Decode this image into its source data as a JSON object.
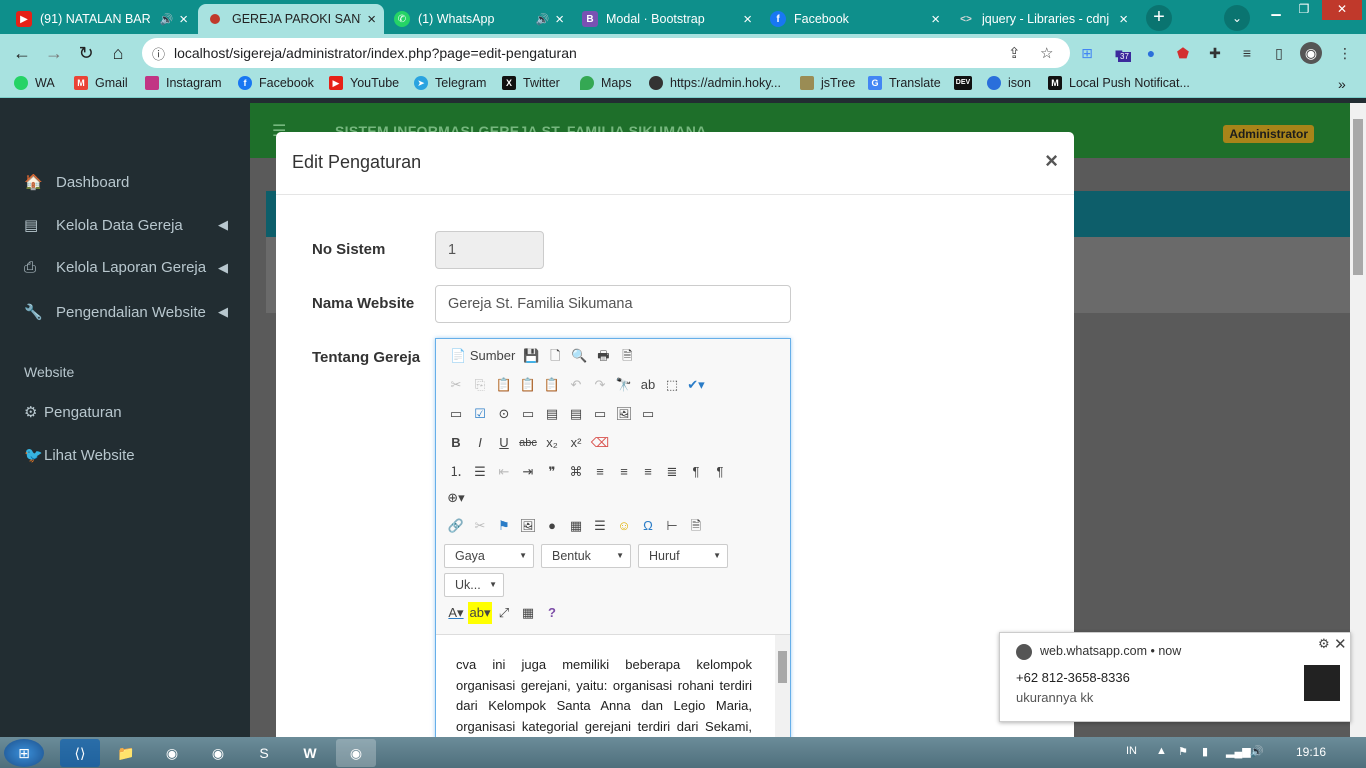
{
  "browser": {
    "tabs": [
      {
        "title": "(91) NATALAN BAR",
        "icon": "youtube-icon",
        "active": false
      },
      {
        "title": "GEREJA PAROKI SANTA",
        "icon": "site-icon",
        "active": true
      },
      {
        "title": "(1) WhatsApp",
        "icon": "whatsapp-icon",
        "active": false
      },
      {
        "title": "Modal · Bootstrap",
        "icon": "bootstrap-icon",
        "active": false
      },
      {
        "title": "Facebook",
        "icon": "facebook-icon",
        "active": false
      },
      {
        "title": "jquery - Libraries - cdnj",
        "icon": "cdnjs-icon",
        "active": false
      }
    ],
    "new_tab": "+",
    "url": "localhost/sigereja/administrator/index.php?page=edit-pengaturan",
    "extension_badge": "37",
    "bookmarks": [
      "WA",
      "Gmail",
      "Instagram",
      "Facebook",
      "YouTube",
      "Telegram",
      "Twitter",
      "Maps",
      "https://admin.hoky...",
      "jsTree",
      "Translate",
      "ison",
      "Local Push Notificat..."
    ]
  },
  "app": {
    "brand": "SISTEM INFORMASI GEREJA ST. FAMILIA SIKUMANA",
    "user_label": "Administrator",
    "sidebar": {
      "items": [
        {
          "label": "Dashboard",
          "icon": "dashboard-icon",
          "chevron": false
        },
        {
          "label": "Kelola Data Gereja",
          "icon": "book-icon",
          "chevron": true
        },
        {
          "label": "Kelola Laporan Gereja",
          "icon": "print-icon",
          "chevron": true
        },
        {
          "label": "Pengendalian Website",
          "icon": "wrench-icon",
          "chevron": true
        }
      ],
      "section_header": "Website",
      "section_items": [
        {
          "label": "Pengaturan",
          "icon": "gear-icon"
        },
        {
          "label": "Lihat Website",
          "icon": "twitter-icon"
        }
      ]
    }
  },
  "modal": {
    "title": "Edit Pengaturan",
    "close": "×",
    "fields": {
      "no_sistem": {
        "label": "No Sistem",
        "value": "1"
      },
      "nama_website": {
        "label": "Nama Website",
        "value": "Gereja St. Familia Sikumana"
      },
      "tentang_gereja": {
        "label": "Tentang Gereja"
      }
    },
    "editor": {
      "source_label": "Sumber",
      "styles": "Gaya",
      "format": "Bentuk",
      "font": "Huruf",
      "size": "Uk...",
      "content": "cva ini juga memiliki beberapa kelompok organisasi gerejani, yaitu: organisasi rohani terdiri dari Kelompok Santa Anna dan Legio Maria, organisasi kategorial gerejani terdiri dari Sekami, OMK, THS"
    }
  },
  "notification": {
    "source": "web.whatsapp.com",
    "time": "now",
    "sender": "+62 812-3658-8336",
    "message": "ukurannya kk"
  },
  "taskbar": {
    "language": "IN",
    "time": "19:16"
  }
}
